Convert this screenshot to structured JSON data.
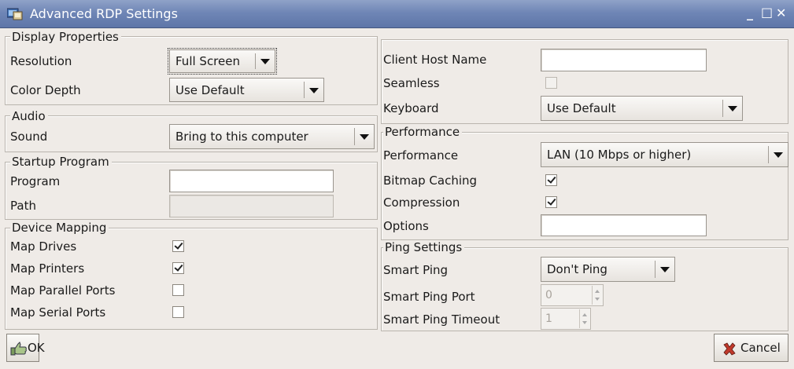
{
  "window": {
    "title": "Advanced RDP Settings",
    "controls": {
      "minimize": "_",
      "maximize": "□",
      "close": "✕"
    }
  },
  "display": {
    "group_label": "Display Properties",
    "resolution_label": "Resolution",
    "resolution_value": "Full Screen",
    "color_depth_label": "Color Depth",
    "color_depth_value": "Use Default"
  },
  "audio": {
    "group_label": "Audio",
    "sound_label": "Sound",
    "sound_value": "Bring to this computer"
  },
  "startup": {
    "group_label": "Startup Program",
    "program_label": "Program",
    "program_value": "",
    "path_label": "Path",
    "path_value": ""
  },
  "device_mapping": {
    "group_label": "Device Mapping",
    "items": [
      {
        "label": "Map Drives",
        "checked": true
      },
      {
        "label": "Map Printers",
        "checked": true
      },
      {
        "label": "Map Parallel Ports",
        "checked": false
      },
      {
        "label": "Map Serial Ports",
        "checked": false
      }
    ]
  },
  "general": {
    "client_host_label": "Client Host Name",
    "client_host_value": "",
    "seamless_label": "Seamless",
    "seamless_checked": false,
    "keyboard_label": "Keyboard",
    "keyboard_value": "Use Default"
  },
  "performance": {
    "group_label": "Performance",
    "performance_label": "Performance",
    "performance_value": "LAN (10 Mbps or higher)",
    "bitmap_label": "Bitmap Caching",
    "bitmap_checked": true,
    "compression_label": "Compression",
    "compression_checked": true,
    "options_label": "Options",
    "options_value": ""
  },
  "ping": {
    "group_label": "Ping Settings",
    "smart_ping_label": "Smart Ping",
    "smart_ping_value": "Don't Ping",
    "port_label": "Smart Ping Port",
    "port_value": "0",
    "timeout_label": "Smart Ping Timeout",
    "timeout_value": "1"
  },
  "buttons": {
    "ok_label": "OK",
    "cancel_label": "Cancel"
  }
}
